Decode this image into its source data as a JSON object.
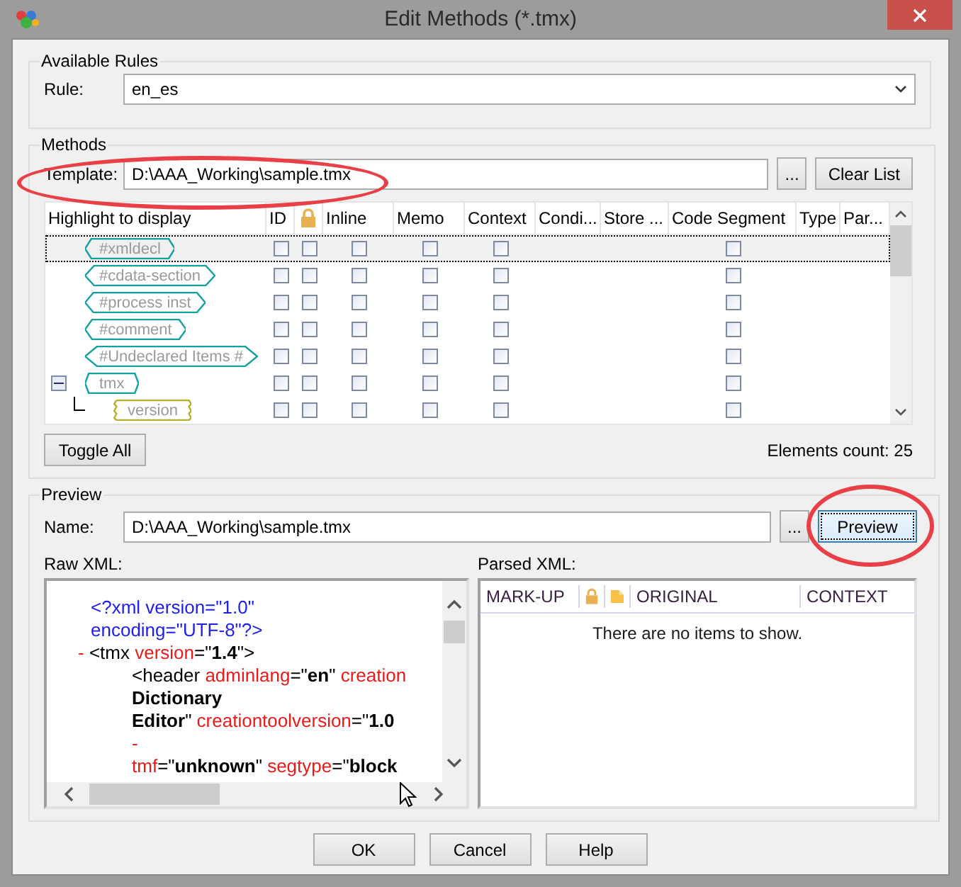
{
  "window": {
    "title": "Edit Methods (*.tmx)"
  },
  "available_rules": {
    "title": "Available Rules",
    "rule_label": "Rule:",
    "rule_value": "en_es"
  },
  "methods": {
    "title": "Methods",
    "template_label": "Template:",
    "template_value": "D:\\AAA_Working\\sample.tmx",
    "browse_button": "...",
    "clear_button": "Clear List",
    "columns": [
      {
        "kind": "text",
        "label": "Highlight to display"
      },
      {
        "kind": "check",
        "label": "ID"
      },
      {
        "kind": "lock"
      },
      {
        "kind": "check",
        "label": "Inline"
      },
      {
        "kind": "check",
        "label": "Memo"
      },
      {
        "kind": "check",
        "label": "Context"
      },
      {
        "kind": "text",
        "label": "Condi..."
      },
      {
        "kind": "text",
        "label": "Store ..."
      },
      {
        "kind": "check",
        "label": "Code Segment"
      },
      {
        "kind": "text",
        "label": "Type"
      },
      {
        "kind": "text",
        "label": "Par..."
      }
    ],
    "rows": [
      {
        "label": "#xmldecl",
        "kind": "node",
        "selected": true,
        "checks": [
          {
            "checked": false
          },
          {
            "checked": false
          },
          {
            "checked": false
          },
          {
            "checked": false
          },
          {
            "checked": false
          },
          {
            "checked": false
          }
        ]
      },
      {
        "label": "#cdata-section",
        "kind": "node",
        "selected": false,
        "checks": [
          {
            "checked": false
          },
          {
            "checked": false
          },
          {
            "checked": false
          },
          {
            "checked": false
          },
          {
            "checked": false
          },
          {
            "checked": false
          }
        ]
      },
      {
        "label": "#process inst",
        "kind": "node",
        "selected": false,
        "checks": [
          {
            "checked": false
          },
          {
            "checked": false
          },
          {
            "checked": false
          },
          {
            "checked": false
          },
          {
            "checked": false
          },
          {
            "checked": false
          }
        ]
      },
      {
        "label": "#comment",
        "kind": "node",
        "selected": false,
        "checks": [
          {
            "checked": false
          },
          {
            "checked": false
          },
          {
            "checked": false
          },
          {
            "checked": false
          },
          {
            "checked": false
          },
          {
            "checked": false
          }
        ]
      },
      {
        "label": "#Undeclared Items #",
        "kind": "node",
        "selected": false,
        "checks": [
          {
            "checked": false
          },
          {
            "checked": false
          },
          {
            "checked": false
          },
          {
            "checked": false
          },
          {
            "checked": false
          },
          {
            "checked": false
          }
        ]
      },
      {
        "label": "tmx",
        "kind": "node",
        "selected": false,
        "expanded": true,
        "checks": [
          {
            "checked": false
          },
          {
            "checked": false
          },
          {
            "checked": false
          },
          {
            "checked": false
          },
          {
            "checked": false
          },
          {
            "checked": false
          }
        ],
        "children": [
          {
            "label": "version",
            "kind": "attribute",
            "selected": false,
            "checks": [
              {
                "checked": false
              },
              {
                "checked": false
              },
              {
                "checked": false
              },
              {
                "checked": false
              },
              {
                "checked": false
              },
              {
                "checked": false
              }
            ]
          }
        ]
      }
    ],
    "toggle_button": "Toggle All",
    "count": "Elements count: 25"
  },
  "preview": {
    "title": "Preview",
    "name_label": "Name:",
    "name_value": "D:\\AAA_Working\\sample.tmx",
    "browse_button": "...",
    "preview_button": "Preview",
    "raw_label": "Raw XML:",
    "parsed_label": "Parsed XML:",
    "raw_lines": [
      {
        "kind": "declaration",
        "segments": [
          {
            "kind": "pi",
            "text": "<?xml version=\"1.0\""
          }
        ]
      },
      {
        "kind": "declaration",
        "segments": [
          {
            "kind": "pi",
            "text": "encoding=\"UTF-8\"?>"
          }
        ]
      },
      {
        "kind": "root",
        "segments": [
          {
            "kind": "marker",
            "text": "- "
          },
          {
            "kind": "plain",
            "text": "<tmx "
          },
          {
            "kind": "attr",
            "text": "version"
          },
          {
            "kind": "plain",
            "text": "=\""
          },
          {
            "kind": "value",
            "text": "1.4"
          },
          {
            "kind": "plain",
            "text": "\">"
          }
        ]
      },
      {
        "kind": "child",
        "segments": [
          {
            "kind": "plain",
            "text": "<header "
          },
          {
            "kind": "attr",
            "text": "adminlang"
          },
          {
            "kind": "plain",
            "text": "=\""
          },
          {
            "kind": "value",
            "text": "en"
          },
          {
            "kind": "plain",
            "text": "\" "
          },
          {
            "kind": "attr",
            "text": "creation"
          }
        ]
      },
      {
        "kind": "child",
        "segments": [
          {
            "kind": "value",
            "text": "Dictionary"
          }
        ]
      },
      {
        "kind": "child",
        "segments": [
          {
            "kind": "value",
            "text": "Editor"
          },
          {
            "kind": "plain",
            "text": "\" "
          },
          {
            "kind": "attr",
            "text": "creationtoolversion"
          },
          {
            "kind": "plain",
            "text": "=\""
          },
          {
            "kind": "value",
            "text": "1.0"
          }
        ]
      },
      {
        "kind": "child",
        "segments": [
          {
            "kind": "marker",
            "text": "-"
          }
        ]
      },
      {
        "kind": "child",
        "segments": [
          {
            "kind": "attr",
            "text": "tmf"
          },
          {
            "kind": "plain",
            "text": "=\""
          },
          {
            "kind": "value",
            "text": "unknown"
          },
          {
            "kind": "plain",
            "text": "\" "
          },
          {
            "kind": "attr",
            "text": "segtype"
          },
          {
            "kind": "plain",
            "text": "=\""
          },
          {
            "kind": "value",
            "text": "block"
          }
        ]
      }
    ],
    "parsed_columns": [
      {
        "kind": "text",
        "label": "MARK-UP"
      },
      {
        "kind": "lock"
      },
      {
        "kind": "note"
      },
      {
        "kind": "text",
        "label": "ORIGINAL"
      },
      {
        "kind": "text",
        "label": "CONTEXT"
      }
    ],
    "empty_message": "There are no items to show."
  },
  "buttons": [
    {
      "label": "OK"
    },
    {
      "label": "Cancel"
    },
    {
      "label": "Help"
    }
  ]
}
